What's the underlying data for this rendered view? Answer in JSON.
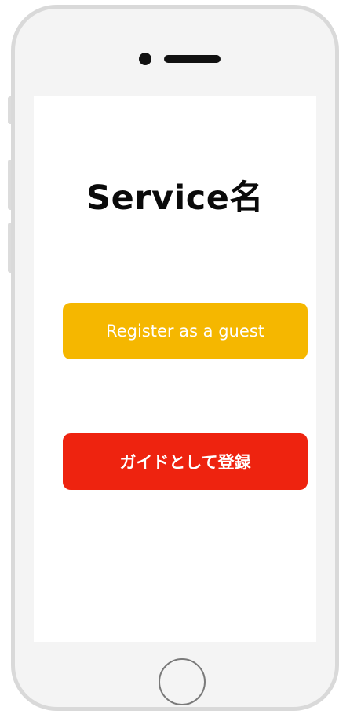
{
  "app": {
    "title": "Service名"
  },
  "actions": {
    "guest_label": "Register as a guest",
    "guide_label": "ガイドとして登録"
  },
  "colors": {
    "guest_button": "#f5b700",
    "guide_button": "#ee230f",
    "phone_frame": "#f4f4f4",
    "phone_border": "#d9d9d9"
  },
  "icons": {
    "home": "home-button-icon",
    "speaker": "speaker-icon",
    "camera": "front-camera-icon"
  }
}
